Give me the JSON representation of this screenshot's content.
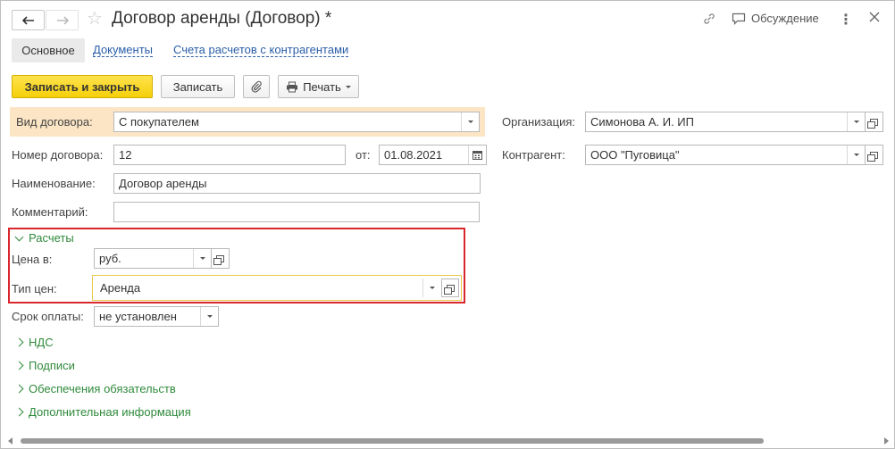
{
  "window": {
    "title": "Договор аренды (Договор) *",
    "discuss_label": "Обсуждение"
  },
  "tabs": [
    {
      "label": "Основное",
      "active": true
    },
    {
      "label": "Документы",
      "active": false
    },
    {
      "label": "Счета расчетов с контрагентами",
      "active": false
    }
  ],
  "toolbar": {
    "save_close_label": "Записать и закрыть",
    "save_label": "Записать",
    "print_label": "Печать"
  },
  "form": {
    "contract_kind": {
      "label": "Вид договора:",
      "value": "С покупателем"
    },
    "organization": {
      "label": "Организация:",
      "value": "Симонова А. И. ИП"
    },
    "contract_number": {
      "label": "Номер договора:",
      "value": "12"
    },
    "date": {
      "label": "от:",
      "value": "01.08.2021"
    },
    "counterparty": {
      "label": "Контрагент:",
      "value": "ООО \"Пуговица\""
    },
    "name": {
      "label": "Наименование:",
      "value": "Договор аренды"
    },
    "comment": {
      "label": "Комментарий:",
      "value": ""
    }
  },
  "settlements": {
    "title": "Расчеты",
    "price_in": {
      "label": "Цена в:",
      "value": "руб."
    },
    "price_type": {
      "label": "Тип цен:",
      "value": "Аренда"
    }
  },
  "payment_term": {
    "label": "Срок оплаты:",
    "value": "не установлен"
  },
  "groups": [
    {
      "title": "НДС"
    },
    {
      "title": "Подписи"
    },
    {
      "title": "Обеспечения обязательств"
    },
    {
      "title": "Дополнительная информация"
    }
  ],
  "colors": {
    "accent_green": "#2f8a3b",
    "link_blue": "#2a5ea8",
    "primary_yellow": "#f5cf0a",
    "highlight_bg": "#fbe5c4",
    "annotation_red": "#d9272d"
  }
}
